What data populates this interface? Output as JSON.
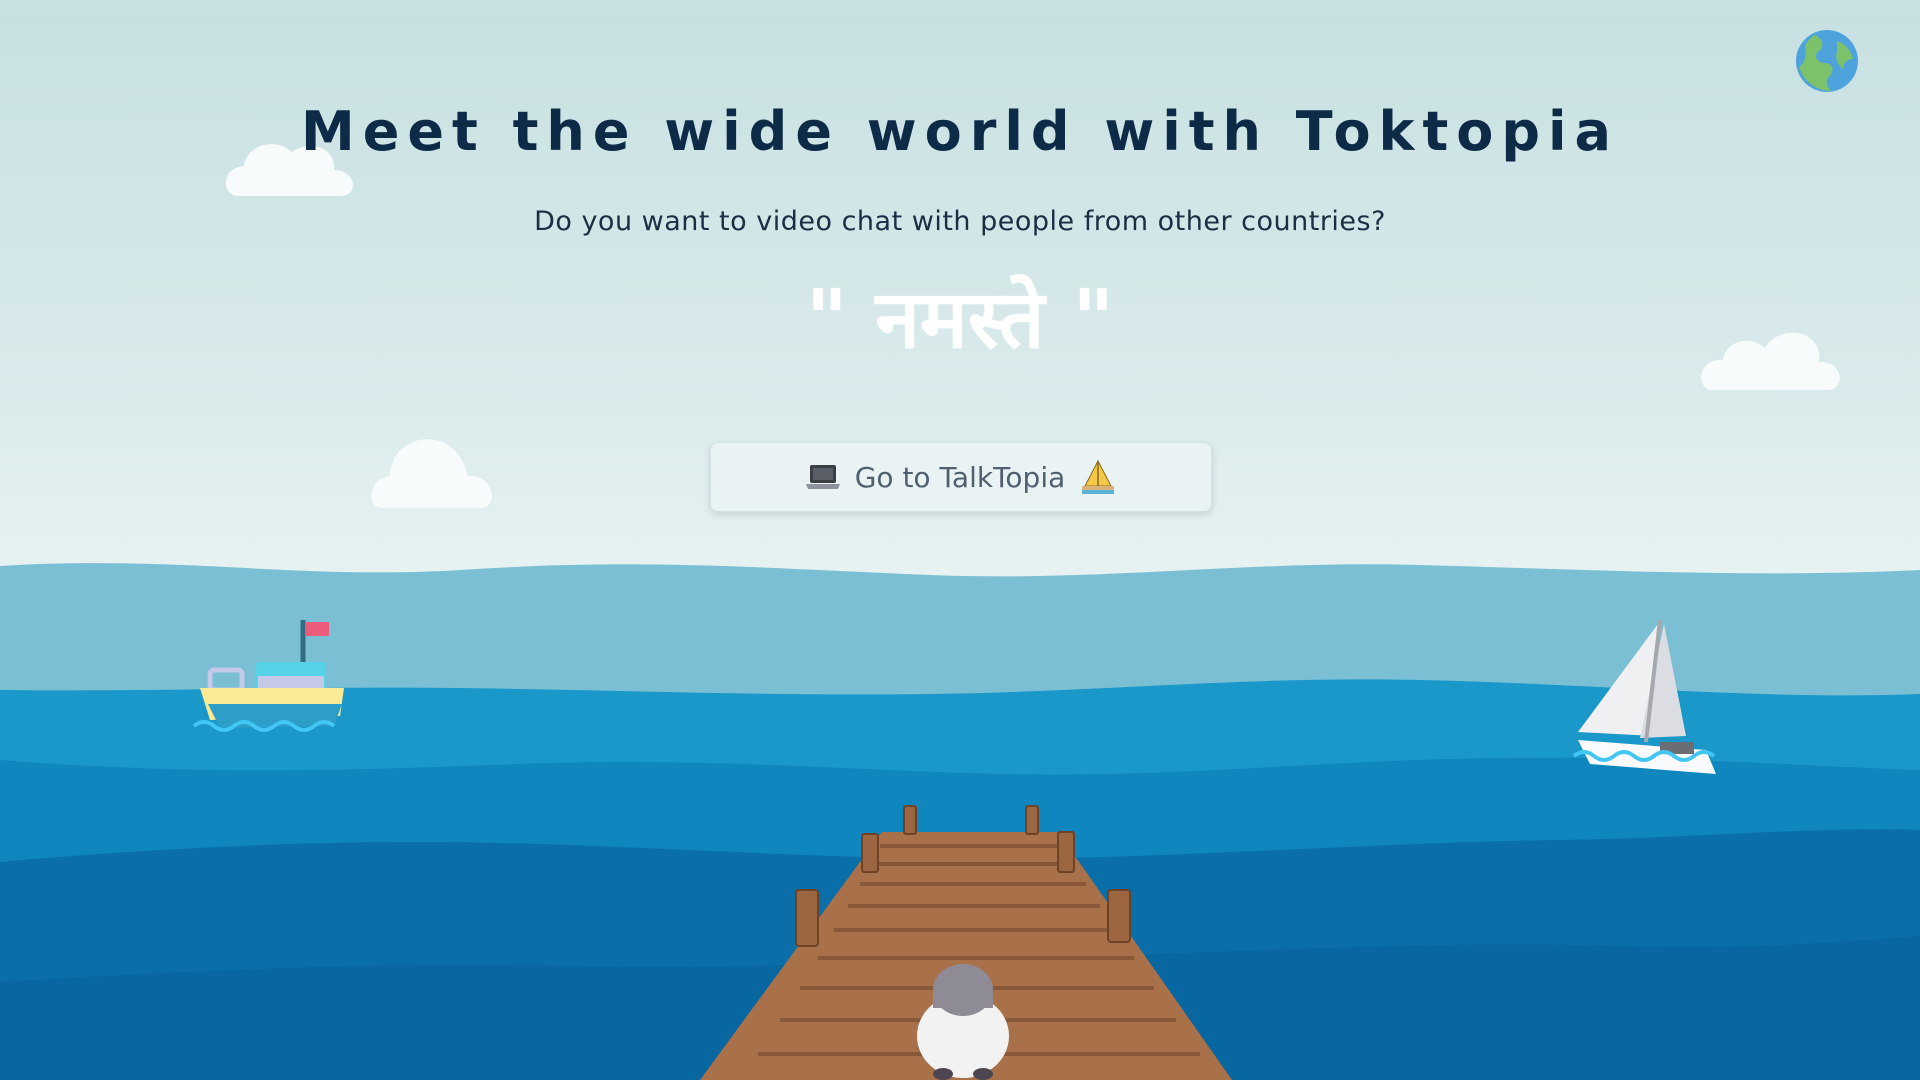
{
  "header": {
    "title": "Meet the wide world with Toktopia",
    "subtitle": "Do you want to video chat with people from other countries?",
    "greeting": "\" नमस्ते \""
  },
  "cta": {
    "label": "Go to TalkTopia",
    "leading_icon": "laptop-icon",
    "trailing_icon": "sailboat-icon"
  },
  "language_button": {
    "icon": "globe-icon"
  },
  "colors": {
    "title": "#0d2a47",
    "sky_top": "#c7e0e1",
    "sea_light": "#7bbfd4",
    "sea_mid": "#1a98c9",
    "sea_deep": "#0a6fa8"
  }
}
